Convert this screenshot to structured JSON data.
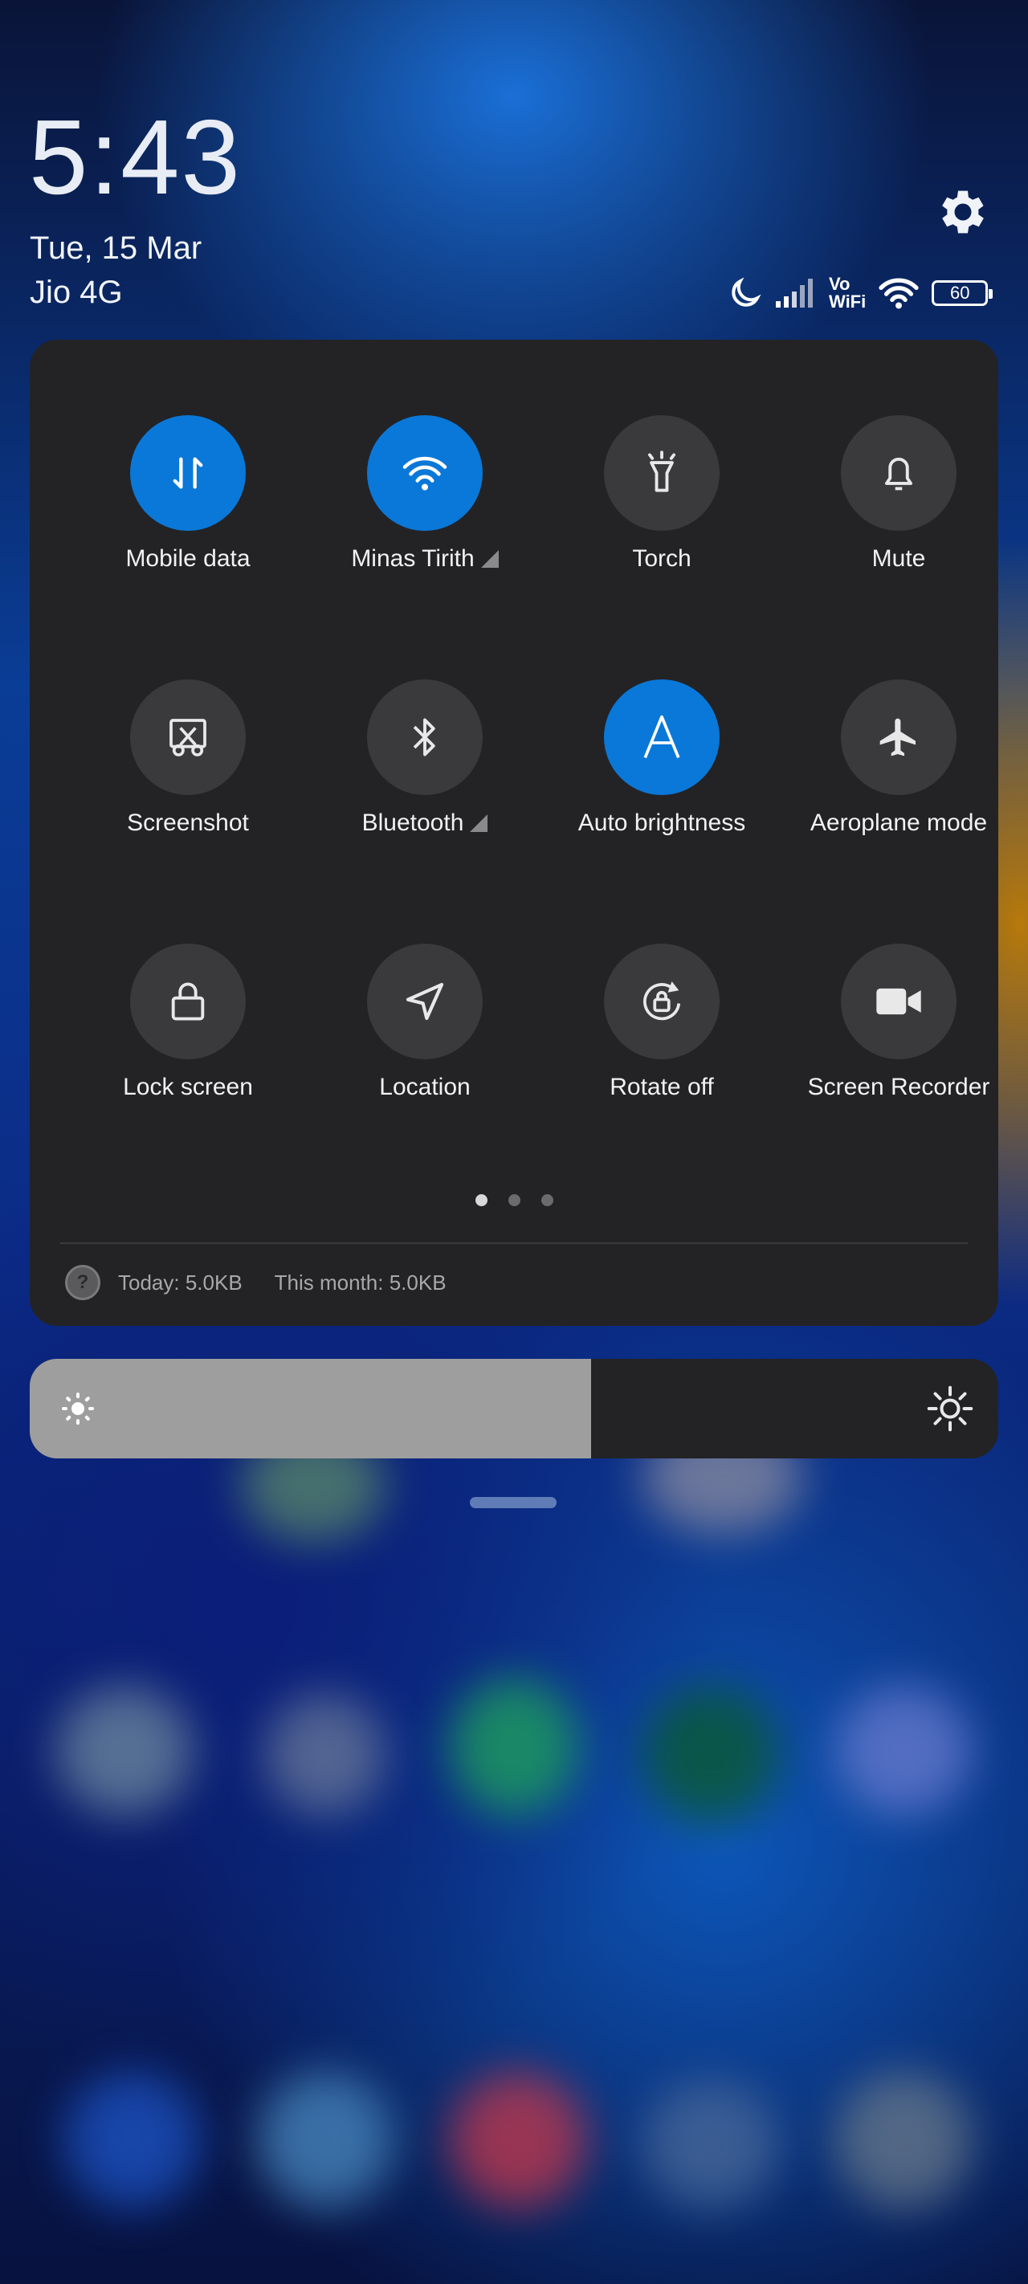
{
  "status": {
    "time": "5:43",
    "date": "Tue, 15 Mar",
    "carrier": "Jio 4G",
    "vowifi_top": "Vo",
    "vowifi_bottom": "WiFi",
    "battery": "60"
  },
  "tiles": [
    {
      "label": "Mobile data",
      "icon": "mobile-data-icon",
      "active": true
    },
    {
      "label": "Minas Tirith",
      "icon": "wifi-icon",
      "active": true,
      "expandable": true
    },
    {
      "label": "Torch",
      "icon": "torch-icon",
      "active": false
    },
    {
      "label": "Mute",
      "icon": "bell-icon",
      "active": false
    },
    {
      "label": "Screenshot",
      "icon": "screenshot-icon",
      "active": false
    },
    {
      "label": "Bluetooth",
      "icon": "bluetooth-icon",
      "active": false,
      "expandable": true
    },
    {
      "label": "Auto brightness",
      "icon": "auto-brightness-icon",
      "active": true
    },
    {
      "label": "Aeroplane mode",
      "icon": "airplane-icon",
      "active": false
    },
    {
      "label": "Lock screen",
      "icon": "lock-icon",
      "active": false
    },
    {
      "label": "Location",
      "icon": "location-icon",
      "active": false
    },
    {
      "label": "Rotate off",
      "icon": "rotate-lock-icon",
      "active": false
    },
    {
      "label": "Screen Recorder",
      "icon": "video-camera-icon",
      "active": false
    }
  ],
  "pager": {
    "pages": 3,
    "current": 1
  },
  "data_usage": {
    "today": "Today: 5.0KB",
    "month": "This month: 5.0KB"
  },
  "brightness": {
    "level": 0.58
  },
  "colors": {
    "accent": "#0a78d8",
    "panel": "#232326",
    "tile_off": "#3a3a3d"
  }
}
